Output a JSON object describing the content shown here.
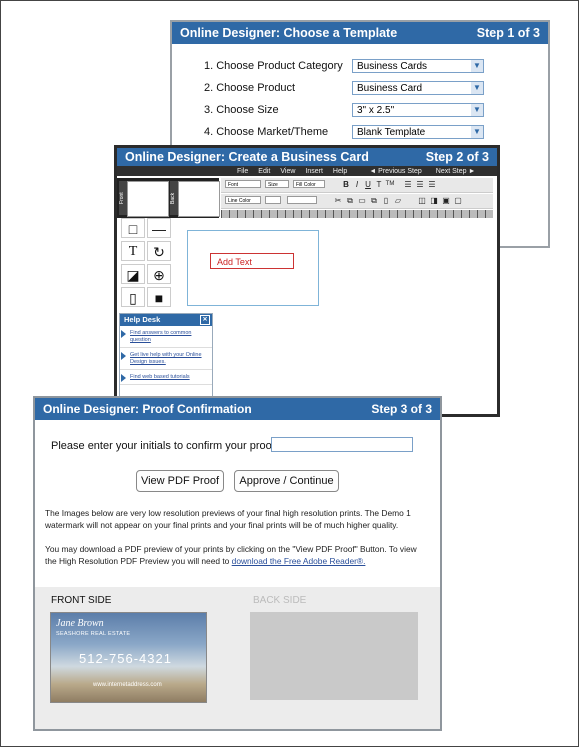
{
  "step1": {
    "title": "Online Designer: Choose a Template",
    "step": "Step 1 of 3",
    "rows": [
      {
        "label": "1. Choose Product Category",
        "value": "Business Cards"
      },
      {
        "label": "2. Choose Product",
        "value": "Business Card"
      },
      {
        "label": "3. Choose Size",
        "value": "3\" x 2.5\""
      },
      {
        "label": "4. Choose Market/Theme",
        "value": "Blank Template"
      }
    ]
  },
  "step2": {
    "title": "Online Designer: Create a Business Card",
    "step": "Step 2 of 3",
    "menu": [
      "File",
      "Edit",
      "View",
      "Insert",
      "Help"
    ],
    "prev": "◄ Previous Step",
    "next": "Next Step ►",
    "front_label": "Front",
    "back_label": "Back",
    "font_label": "Font",
    "size_label": "Size",
    "fill_label": "Fill Color",
    "line_label": "Line Color",
    "text_tools": [
      "B",
      "I",
      "U",
      "T",
      "TM"
    ],
    "canvas_text": "Add Text",
    "helpdesk": {
      "title": "Help Desk",
      "links": [
        "Find answers to common question",
        "Get live help with your Online Design issues.",
        "Find web based tutorials"
      ]
    }
  },
  "step3": {
    "title": "Online Designer: Proof Confirmation",
    "step": "Step 3 of 3",
    "initials_label": "Please enter your initials to confirm your proof:",
    "view_pdf": "View PDF Proof",
    "approve": "Approve / Continue",
    "para1": "The Images below are very low resolution previews of your final high resolution prints. The Demo 1 watermark will not appear on your final prints and your final prints will be of much higher quality.",
    "para2": "You may download a PDF preview of your prints by clicking on the \"View PDF Proof\" Button. To view the High Resolution PDF Preview you will need to",
    "para2_link": "download the Free Adobe Reader®.",
    "front_side": "FRONT SIDE",
    "back_side": "BACK SIDE",
    "card": {
      "name": "Jane Brown",
      "company": "SEASHORE REAL ESTATE",
      "phone": "512-756-4321",
      "web": "www.internetaddress.com"
    }
  }
}
